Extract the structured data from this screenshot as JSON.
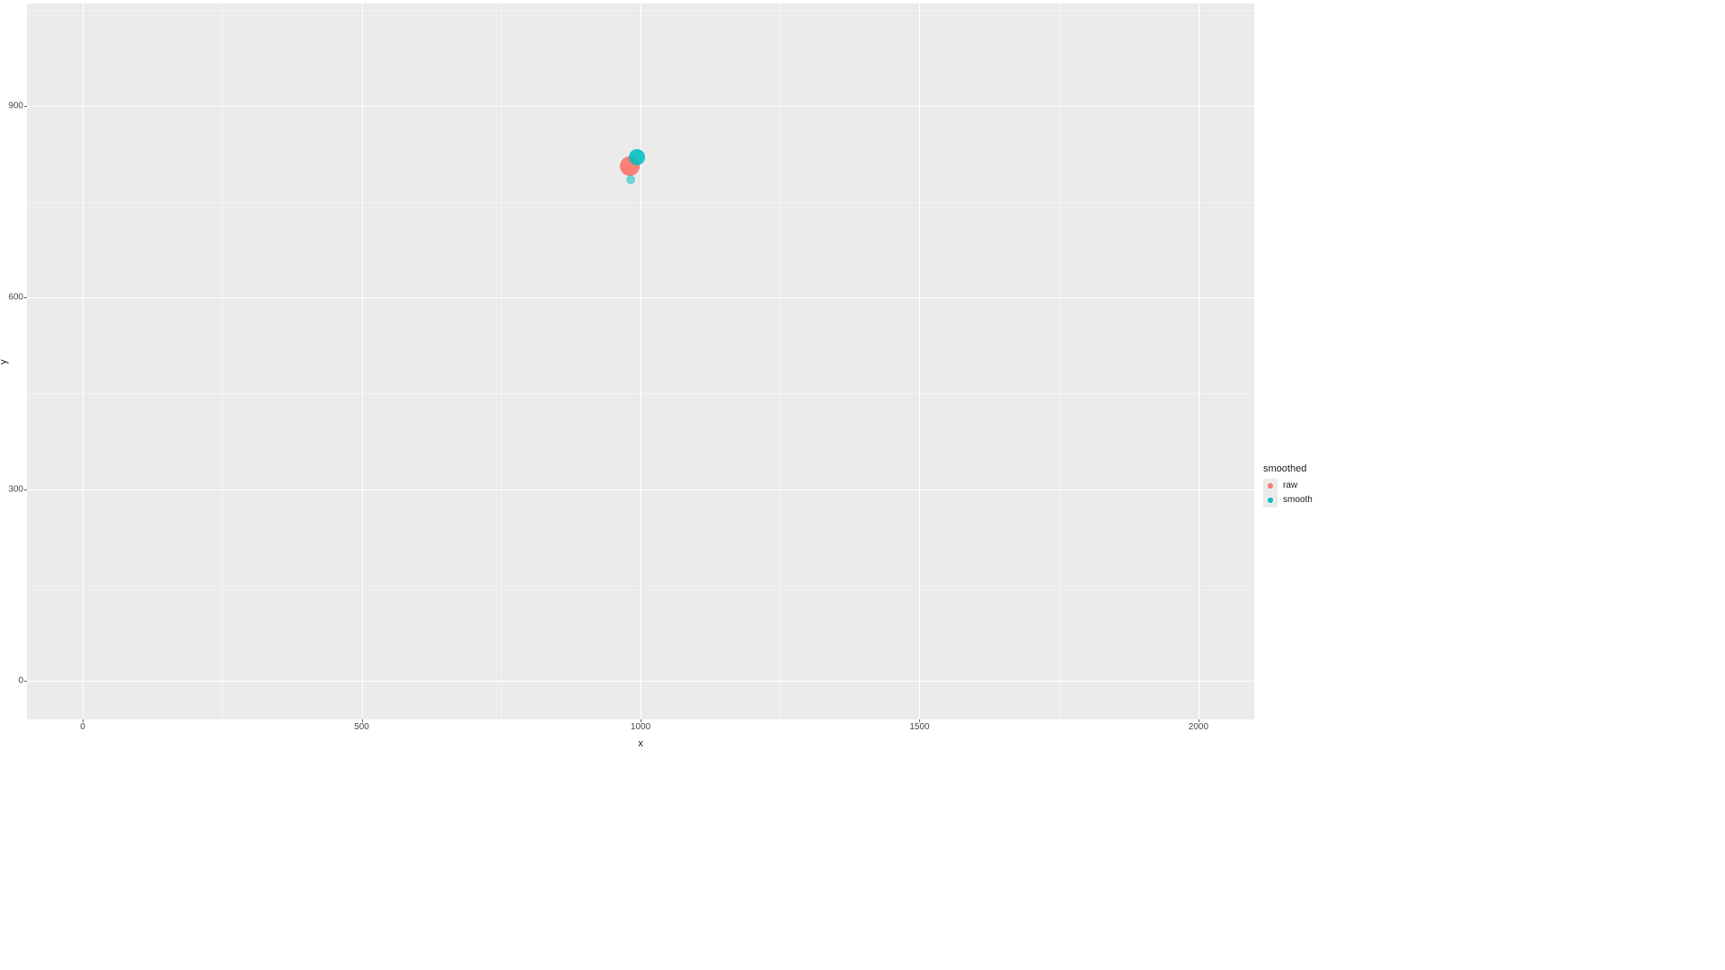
{
  "chart_data": {
    "type": "scatter",
    "xlabel": "x",
    "ylabel": "y",
    "xlim": [
      -100,
      2100
    ],
    "ylim": [
      -60,
      1060
    ],
    "x_ticks": [
      0,
      500,
      1000,
      1500,
      2000
    ],
    "y_ticks": [
      0,
      300,
      600,
      900
    ],
    "legend_title": "smoothed",
    "series": [
      {
        "name": "raw",
        "color": "#F8766D",
        "points": [
          {
            "x": 980,
            "y": 805,
            "size": 22,
            "alpha": 0.92
          }
        ]
      },
      {
        "name": "smooth",
        "color": "#00BFC4",
        "points": [
          {
            "x": 993,
            "y": 820,
            "size": 18,
            "alpha": 0.88
          },
          {
            "x": 982,
            "y": 785,
            "size": 10,
            "alpha": 0.55
          }
        ]
      }
    ]
  },
  "colors": {
    "panel_bg": "#ebebeb",
    "grid": "#ffffff",
    "raw": "#F8766D",
    "smooth": "#00BFC4"
  }
}
